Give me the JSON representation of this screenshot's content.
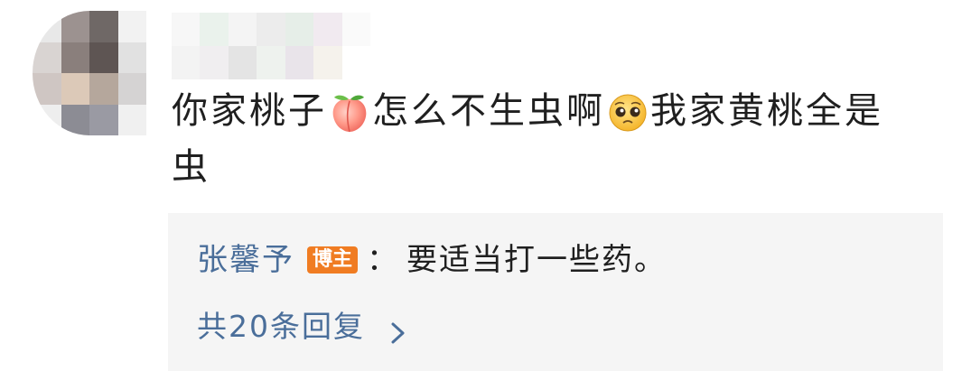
{
  "comment": {
    "text_part1": "你家桃子",
    "emoji_peach": "peach-emoji",
    "text_part2": "怎么不生虫啊",
    "emoji_pleading": "pleading-face-emoji",
    "text_part3": "我家黄桃全是虫"
  },
  "reply": {
    "author": "张馨予",
    "badge": "博主",
    "colon": "：",
    "text": "要适当打一些药。",
    "more_label": "共20条回复"
  },
  "icons": {
    "more": "chevron-right-icon"
  },
  "colors": {
    "link": "#4a6e9a",
    "badge": "#f07c22",
    "reply_bg": "#f5f5f5",
    "text": "#1f1f1f"
  }
}
